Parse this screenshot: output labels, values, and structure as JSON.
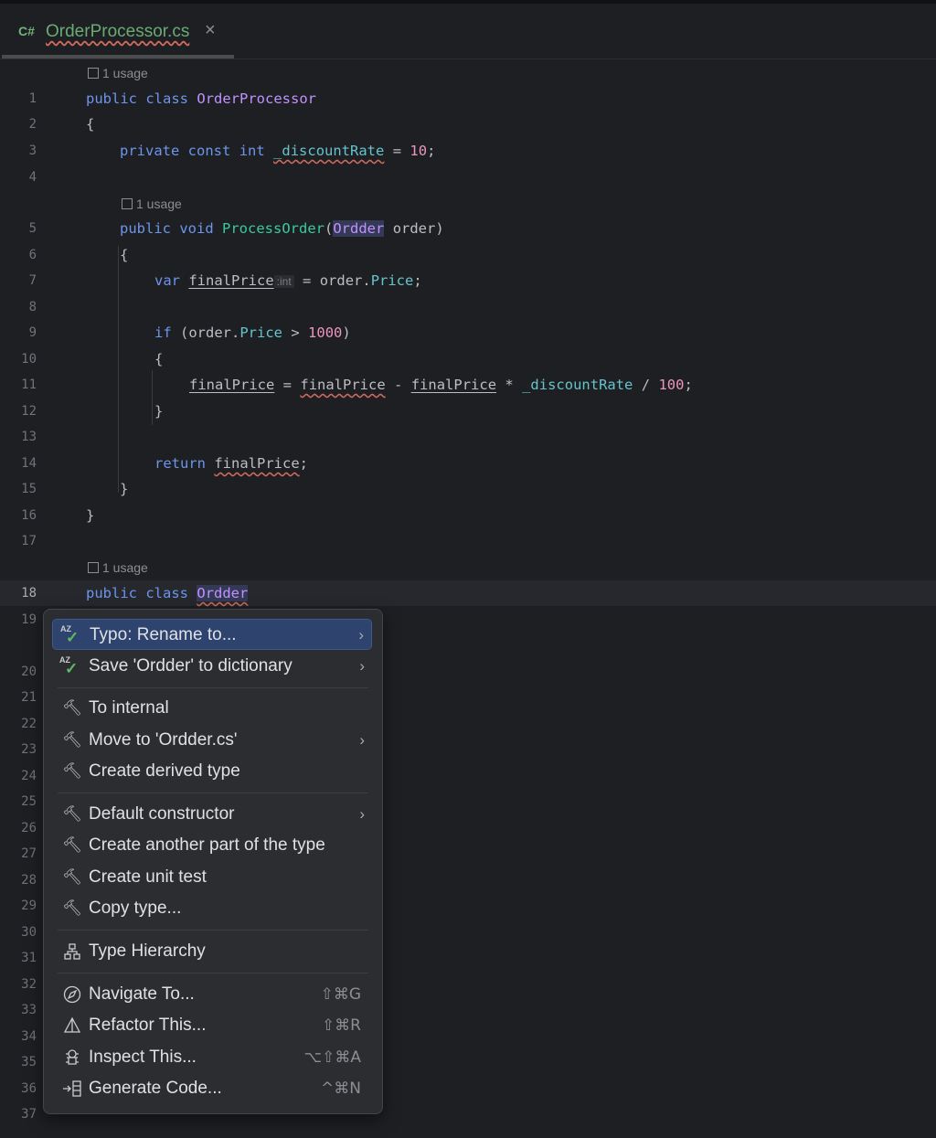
{
  "tab": {
    "lang": "C#",
    "filename": "OrderProcessor.cs",
    "close": "×"
  },
  "usage_label": "1 usage",
  "line_numbers": [
    "1",
    "2",
    "3",
    "4",
    "5",
    "6",
    "7",
    "8",
    "9",
    "10",
    "11",
    "12",
    "13",
    "14",
    "15",
    "16",
    "17",
    "18",
    "19",
    "20",
    "21",
    "22",
    "23",
    "24",
    "25",
    "26",
    "27",
    "28",
    "29",
    "30",
    "31",
    "32",
    "33",
    "34",
    "35",
    "36",
    "37"
  ],
  "code": {
    "l1": [
      "public",
      "class",
      "OrderProcessor"
    ],
    "l2": "{",
    "l3": [
      "private",
      "const",
      "int",
      "_discountRate",
      "=",
      "10",
      ";"
    ],
    "l5": [
      "public",
      "void",
      "ProcessOrder",
      "(",
      "Ordder",
      "order)"
    ],
    "l6": "{",
    "l7": [
      "var",
      "finalPrice",
      ":int",
      "= order.",
      "Price",
      ";"
    ],
    "l9": [
      "if",
      "(order.",
      "Price",
      "> ",
      "1000",
      ")"
    ],
    "l10": "{",
    "l11": [
      "finalPrice",
      "=",
      "finalPrice",
      "-",
      "finalPrice",
      "*",
      "_discountRate",
      "/",
      "100",
      ";"
    ],
    "l12": "}",
    "l14": [
      "return",
      "finalPrice",
      ";"
    ],
    "l15": "}",
    "l16": "}",
    "l18": [
      "public",
      "class",
      "Ordder"
    ]
  },
  "menu": {
    "items": [
      {
        "label": "Typo: Rename to...",
        "icon": "spellcheck-icon",
        "submenu": true
      },
      {
        "label": "Save 'Ordder' to dictionary",
        "icon": "spellcheck-icon",
        "submenu": true
      },
      {
        "label": "To internal",
        "icon": "hammer-icon"
      },
      {
        "label": "Move to 'Ordder.cs'",
        "icon": "hammer-icon",
        "submenu": true
      },
      {
        "label": "Create derived type",
        "icon": "hammer-icon"
      },
      {
        "label": "Default constructor",
        "icon": "hammer-icon",
        "submenu": true
      },
      {
        "label": "Create another part of the type",
        "icon": "hammer-icon"
      },
      {
        "label": "Create unit test",
        "icon": "hammer-icon"
      },
      {
        "label": "Copy type...",
        "icon": "hammer-icon"
      },
      {
        "label": "Type Hierarchy",
        "icon": "hierarchy-icon"
      },
      {
        "label": "Navigate To...",
        "icon": "compass-icon",
        "shortcut": "⇧⌘G"
      },
      {
        "label": "Refactor This...",
        "icon": "refactor-icon",
        "shortcut": "⇧⌘R"
      },
      {
        "label": "Inspect This...",
        "icon": "inspect-icon",
        "shortcut": "⌥⇧⌘A"
      },
      {
        "label": "Generate Code...",
        "icon": "generate-icon",
        "shortcut": "^⌘N"
      }
    ],
    "spell_icon_text": "AZ"
  },
  "colors": {
    "background": "#1e1f22",
    "keyword": "#6c95eb",
    "type": "#c191ff",
    "method": "#39cc9b",
    "field": "#66c3cc",
    "number": "#ed94c0",
    "selected_item": "#2e436e"
  }
}
